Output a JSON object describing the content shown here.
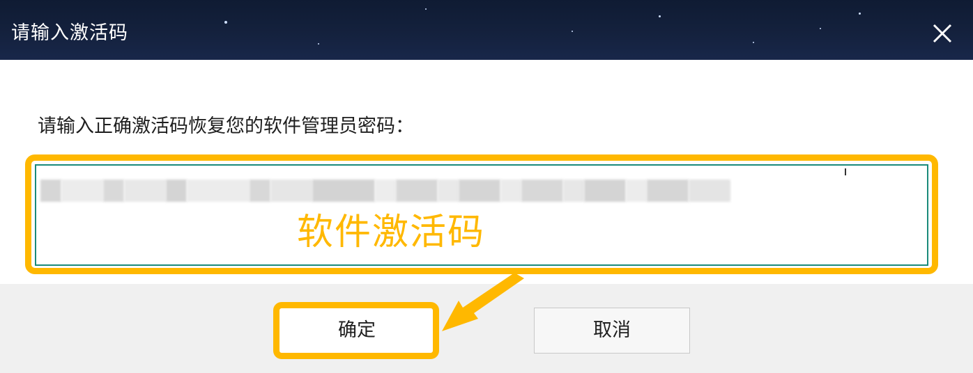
{
  "dialog": {
    "title": "请输入激活码",
    "close_icon": "close-icon"
  },
  "form": {
    "prompt": "请输入正确激活码恢复您的软件管理员密码：",
    "activation_code_value": "",
    "activation_code_blurred": true
  },
  "annotation": {
    "label": "软件激活码",
    "highlight_color": "#ffb800"
  },
  "buttons": {
    "ok_label": "确定",
    "cancel_label": "取消"
  },
  "colors": {
    "titlebar": "#14213d",
    "input_border": "#1a8a7a",
    "footer_bg": "#f0f0f0"
  }
}
